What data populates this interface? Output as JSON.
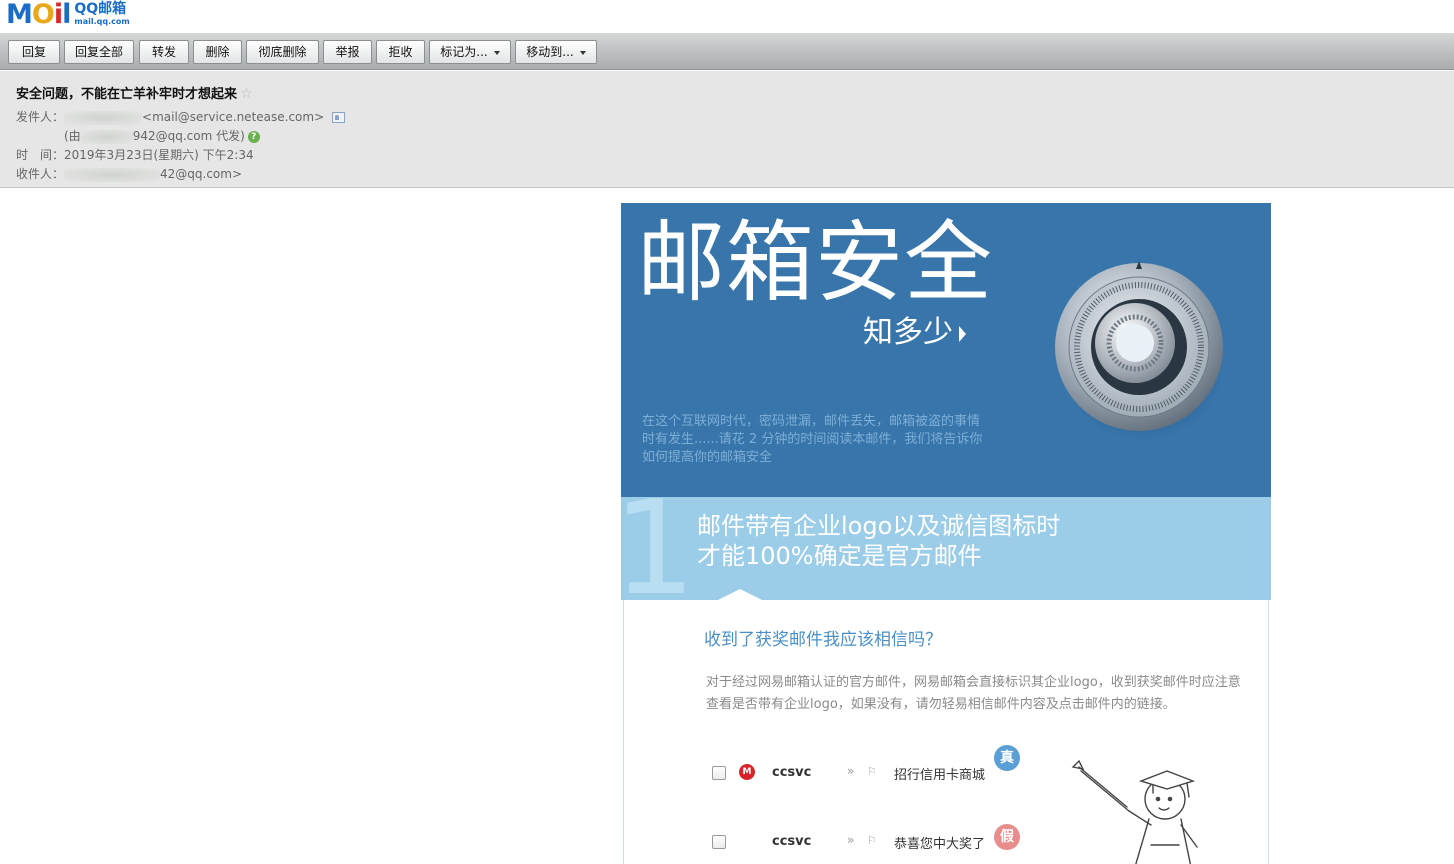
{
  "logo": {
    "word_m": "M",
    "word_o": "O",
    "word_i": "i",
    "word_l": "l",
    "brand": "QQ邮箱",
    "domain": "mail.qq.com"
  },
  "toolbar": {
    "reply": "回复",
    "reply_all": "回复全部",
    "forward": "转发",
    "delete": "删除",
    "delete_forever": "彻底删除",
    "report": "举报",
    "reject": "拒收",
    "mark_as": "标记为...",
    "move_to": "移动到..."
  },
  "mail": {
    "subject": "安全问题，不能在亡羊补牢时才想起来",
    "star": "☆",
    "from_label": "发件人：",
    "from_addr": "<mail@service.netease.com>",
    "via_prefix": "(由",
    "via_addr": "942@qq.com 代发)",
    "help": "?",
    "time_label": "时　间：",
    "time_value": "2019年3月23日(星期六) 下午2:34",
    "to_label": "收件人：",
    "to_addr": "42@qq.com>"
  },
  "newsletter": {
    "hero_title": "邮箱安全",
    "hero_sub": "知多少",
    "hero_intro": "在这个互联网时代，密码泄漏，邮件丢失，邮箱被盗的事情时有发生......请花 2 分钟的时间阅读本邮件，我们将告诉你如何提高你的邮箱安全",
    "section_num": "1",
    "section_title_1": "邮件带有企业logo以及诚信图标时",
    "section_title_2": "才能100%确定是官方邮件",
    "question": "收到了获奖邮件我应该相信吗？",
    "answer": "对于经过网易邮箱认证的官方邮件，网易邮箱会直接标识其企业logo，收到获奖邮件时应注意查看是否带有企业logo，如果没有，请勿轻易相信邮件内容及点击邮件内的链接。",
    "rows": [
      {
        "from": "ccsvc",
        "arrows": "»",
        "subject": "招行信用卡商城",
        "badge": "真"
      },
      {
        "from": "ccsvc",
        "arrows": "»",
        "subject": "恭喜您中大奖了",
        "badge": "假"
      }
    ]
  }
}
